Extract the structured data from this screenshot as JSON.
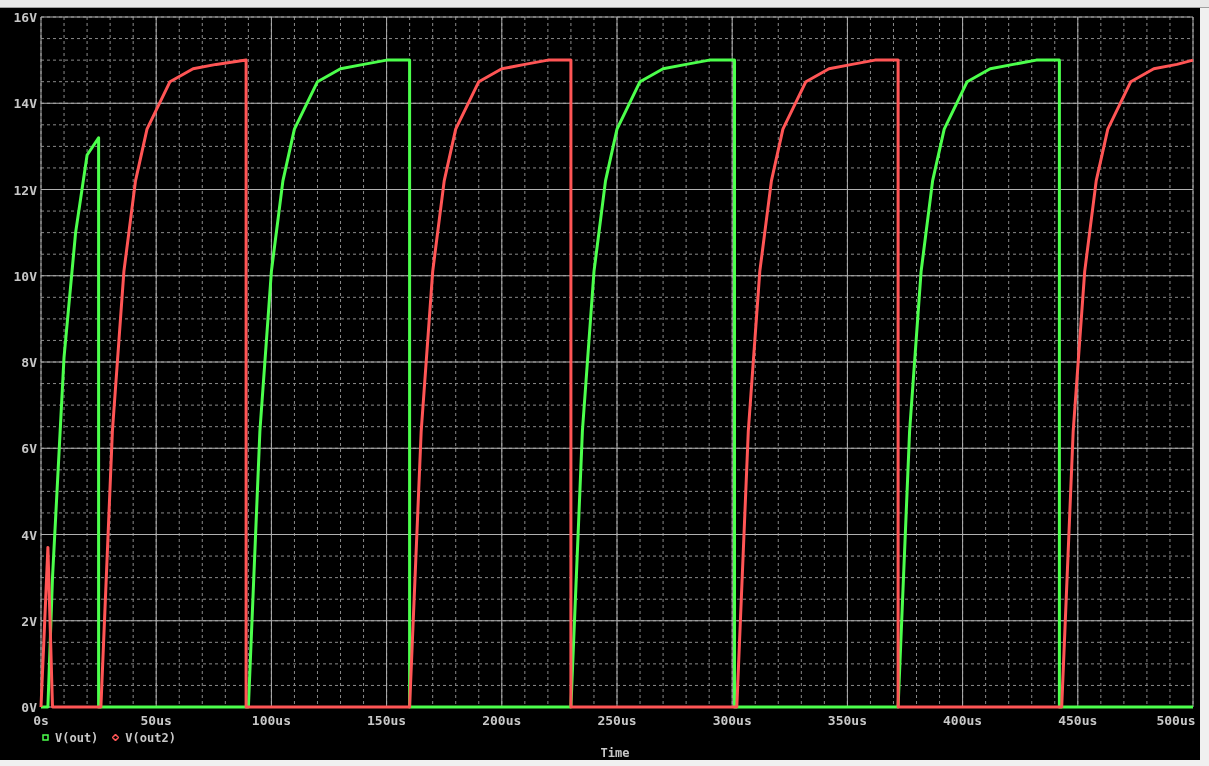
{
  "chart_data": {
    "type": "line",
    "grid": true,
    "xlabel": "Time",
    "xlim": [
      0,
      500
    ],
    "ylim": [
      0,
      16
    ],
    "xticks": [
      {
        "value": 0,
        "label": "0s"
      },
      {
        "value": 50,
        "label": "50us"
      },
      {
        "value": 100,
        "label": "100us"
      },
      {
        "value": 150,
        "label": "150us"
      },
      {
        "value": 200,
        "label": "200us"
      },
      {
        "value": 250,
        "label": "250us"
      },
      {
        "value": 300,
        "label": "300us"
      },
      {
        "value": 350,
        "label": "350us"
      },
      {
        "value": 400,
        "label": "400us"
      },
      {
        "value": 450,
        "label": "450us"
      },
      {
        "value": 500,
        "label": "500us"
      }
    ],
    "yticks": [
      {
        "value": 0,
        "label": "0V"
      },
      {
        "value": 2,
        "label": "2V"
      },
      {
        "value": 4,
        "label": "4V"
      },
      {
        "value": 6,
        "label": "6V"
      },
      {
        "value": 8,
        "label": "8V"
      },
      {
        "value": 10,
        "label": "10V"
      },
      {
        "value": 12,
        "label": "12V"
      },
      {
        "value": 14,
        "label": "14V"
      },
      {
        "value": 16,
        "label": "16V"
      }
    ],
    "x": [
      0,
      3,
      5,
      10,
      15,
      20,
      25,
      25,
      26,
      31,
      36,
      41,
      46,
      56,
      66,
      76,
      89,
      89,
      90,
      95,
      100,
      105,
      110,
      120,
      130,
      140,
      150,
      160,
      160,
      165,
      170,
      175,
      180,
      190,
      200,
      210,
      220,
      230,
      230,
      235,
      240,
      245,
      250,
      260,
      270,
      280,
      290,
      301,
      301,
      302,
      307,
      312,
      317,
      322,
      332,
      342,
      352,
      362,
      372,
      372,
      377,
      382,
      387,
      392,
      402,
      412,
      422,
      432,
      442,
      442,
      443,
      448,
      453,
      458,
      463,
      473,
      483,
      493,
      500
    ],
    "series": [
      {
        "name": "V(out)",
        "color": "#4cff4c",
        "values": [
          0,
          0,
          3.0,
          8.1,
          11.0,
          12.8,
          13.2,
          0,
          0,
          0,
          0,
          0,
          0,
          0,
          0,
          0,
          0,
          0,
          0,
          6.4,
          10.1,
          12.2,
          13.4,
          14.5,
          14.8,
          14.9,
          15,
          15,
          0,
          0,
          0,
          0,
          0,
          0,
          0,
          0,
          0,
          0,
          0,
          6.4,
          10.1,
          12.2,
          13.4,
          14.5,
          14.8,
          14.9,
          15,
          15,
          0,
          0,
          0,
          0,
          0,
          0,
          0,
          0,
          0,
          0,
          0,
          0,
          6.4,
          10.1,
          12.2,
          13.4,
          14.5,
          14.8,
          14.9,
          15,
          15,
          0,
          0,
          0,
          0,
          0,
          0,
          0,
          0,
          0,
          0
        ]
      },
      {
        "name": "V(out2)",
        "color": "#ff5555",
        "values": [
          0,
          3.7,
          0,
          0,
          0,
          0,
          0,
          0,
          0,
          6.4,
          10.1,
          12.2,
          13.4,
          14.5,
          14.8,
          14.9,
          15,
          0,
          0,
          0,
          0,
          0,
          0,
          0,
          0,
          0,
          0,
          0,
          0,
          6.4,
          10.1,
          12.2,
          13.4,
          14.5,
          14.8,
          14.9,
          15,
          15,
          0,
          0,
          0,
          0,
          0,
          0,
          0,
          0,
          0,
          0,
          0,
          0,
          6.4,
          10.1,
          12.2,
          13.4,
          14.5,
          14.8,
          14.9,
          15,
          15,
          0,
          0,
          0,
          0,
          0,
          0,
          0,
          0,
          0,
          0,
          0,
          0,
          6.4,
          10.1,
          12.2,
          13.4,
          14.5,
          14.8,
          14.9,
          15
        ]
      }
    ]
  }
}
